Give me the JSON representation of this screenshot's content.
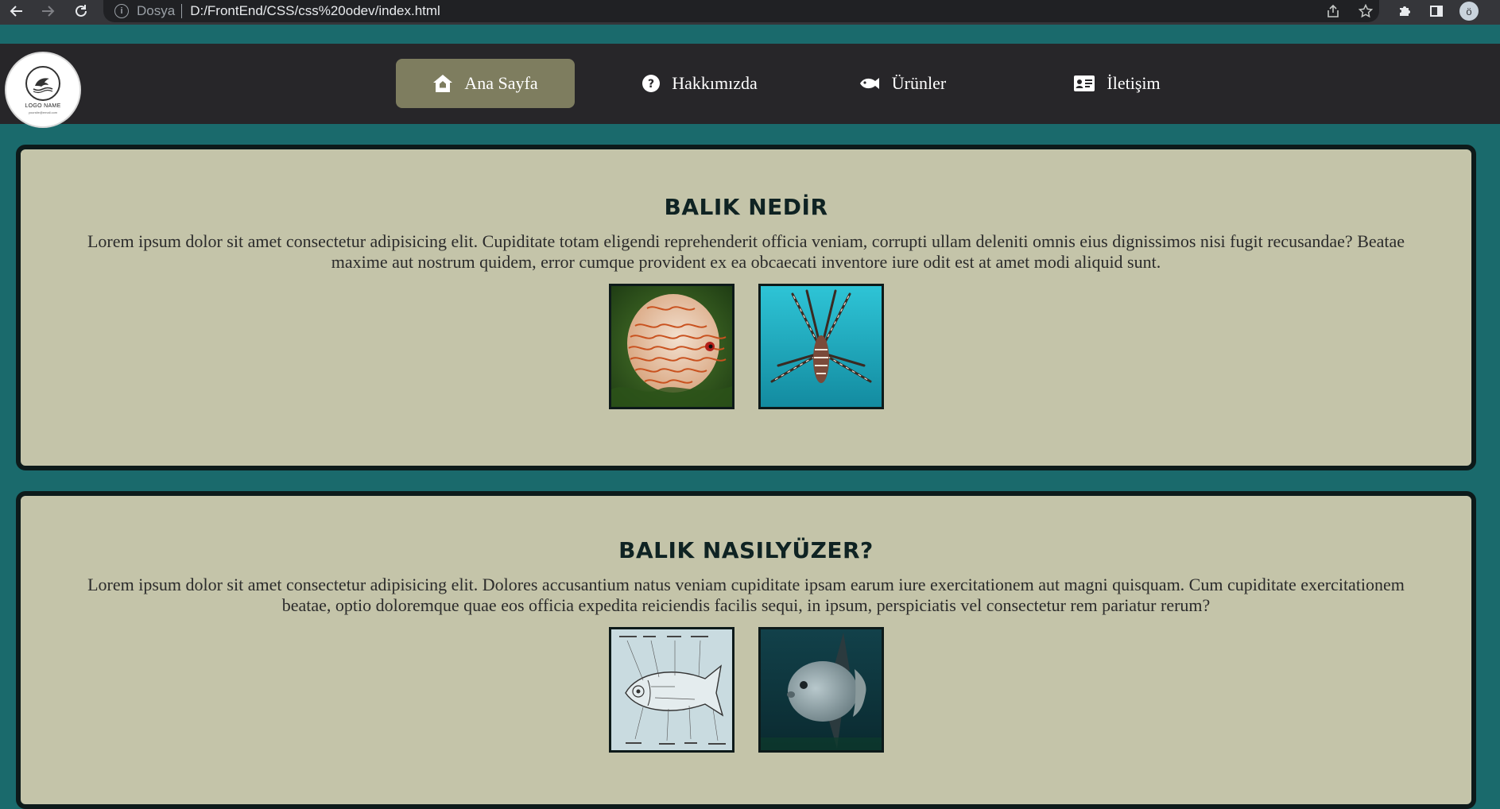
{
  "browser": {
    "scheme_label": "Dosya",
    "url": "D:/FrontEnd/CSS/css%20odev/index.html",
    "profile_initial": "ö"
  },
  "logo": {
    "name": "LOGO NAME",
    "tagline": "yoursite@email.com"
  },
  "nav": {
    "items": [
      {
        "label": "Ana Sayfa",
        "icon": "house-icon",
        "active": true
      },
      {
        "label": "Hakkımızda",
        "icon": "question-circle-icon",
        "active": false
      },
      {
        "label": "Ürünler",
        "icon": "fish-icon",
        "active": false
      },
      {
        "label": "İletişim",
        "icon": "contact-card-icon",
        "active": false
      }
    ]
  },
  "sections": [
    {
      "title": "BALIK NEDİR",
      "text": "Lorem ipsum dolor sit amet consectetur adipisicing elit. Cupiditate totam eligendi reprehenderit officia veniam, corrupti ullam deleniti omnis eius dignissimos nisi fugit recusandae? Beatae maxime aut nostrum quidem, error cumque provident ex ea obcaecati inventore iure odit est at amet modi aliquid sunt.",
      "images": [
        "discus-fish-photo",
        "lionfish-photo"
      ]
    },
    {
      "title": "BALIK NASILYÜZER?",
      "text": "Lorem ipsum dolor sit amet consectetur adipisicing elit. Dolores accusantium natus veniam cupiditate ipsam earum iure exercitationem aut magni quisquam. Cum cupiditate exercitationem beatae, optio doloremque quae eos officia expedita reiciendis facilis sequi, in ipsum, perspiciatis vel consectetur rem pariatur rerum?",
      "images": [
        "fish-anatomy-diagram",
        "sunfish-photo"
      ]
    }
  ],
  "colors": {
    "page_background": "#1a6a6c",
    "header_background": "#272629",
    "active_menu": "#7e7d5f",
    "card_background": "#c4c4a9",
    "card_border": "#0d1a1a"
  }
}
